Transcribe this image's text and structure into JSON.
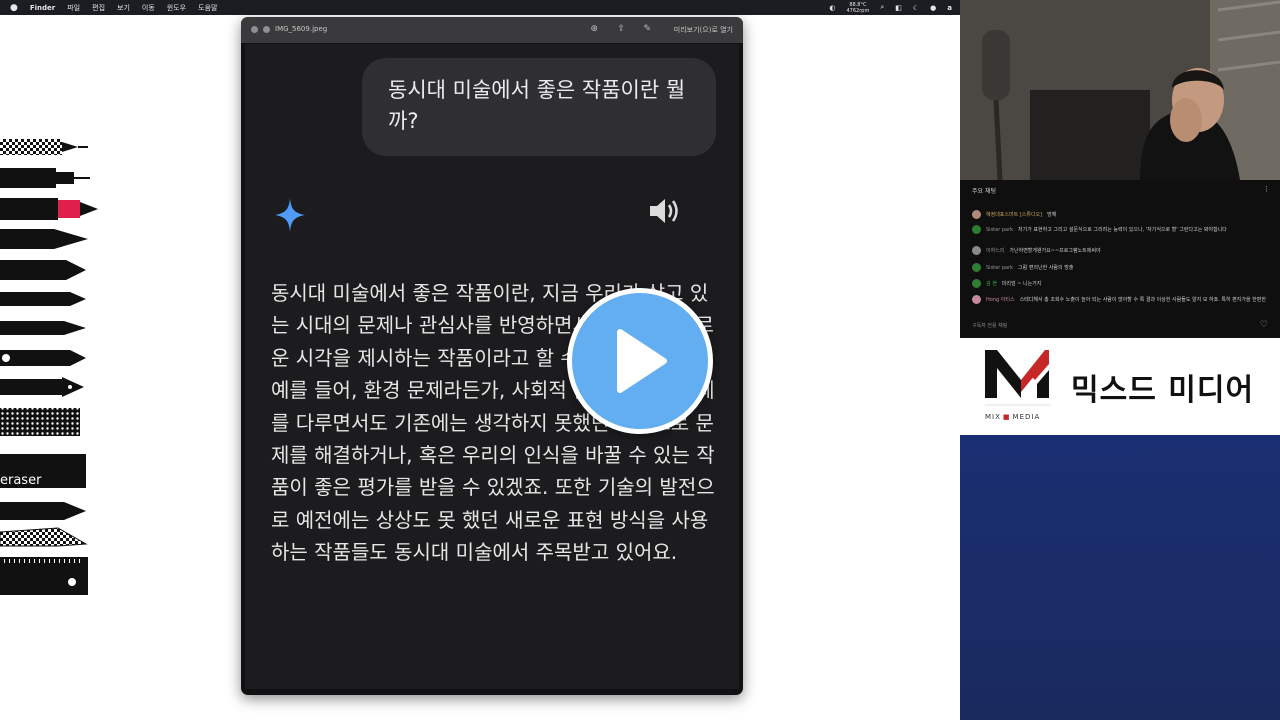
{
  "menubar": {
    "items": [
      "Finder",
      "파일",
      "편집",
      "보기",
      "이동",
      "윈도우",
      "도움말"
    ],
    "weather_temp": "88.8°C",
    "weather_sub": "4762rpm"
  },
  "window": {
    "filename": "IMG_5609.jpeg",
    "open_with": "미리보기(으)로 열기"
  },
  "chat_ui": {
    "prompt": "동시대 미술에서 좋은 작품이란 뭘까?",
    "answer": "동시대 미술에서 좋은 작품이란, 지금 우리가 살고 있는 시대의 문제나 관심사를 반영하면서도 동시에 새로운 시각을 제시하는 작품이라고 할 수 있을 것 같아요. 예를 들어, 환경 문제라든가, 사회적 불평등 같은 주제를 다루면서도 기존에는 생각하지 못했던 방식으로 문제를 해결하거나, 혹은 우리의 인식을 바꿀 수 있는 작품이 좋은 평가를 받을 수 있겠죠. 또한 기술의 발전으로 예전에는 상상도 못 했던 새로운 표현 방식을 사용하는 작품들도 동시대 미술에서 주목받고 있어요."
  },
  "tools": {
    "eraser_label": "eraser"
  },
  "live_chat": {
    "header": "주요 채팅",
    "messages": [
      {
        "name": "혜정대표스마트 [스튜디오]",
        "text": "방해",
        "color": "#c4a35a"
      },
      {
        "name": "Sister park",
        "text": "저기가 표현하고 그리고 설문식으로 그리려는 능력이 있으나, '자기식으로 할' 그런다고는 봐야합니다",
        "color": "#2e7d32"
      },
      {
        "name": "이하느리",
        "text": "가난하면할게왠가요~~프로그램노트에써야",
        "color": "#9e9e9e"
      },
      {
        "name": "Sister park",
        "text": "그럼 편의난한 사람의 방출",
        "color": "#2e7d32"
      },
      {
        "name": "김 현",
        "text": "미리엄 ~ 니는거지",
        "color": "#2e7d32"
      },
      {
        "name": "Hong 아티스",
        "text": "스테디해서 총 조회수 노출이 높아 되는 사람이 많아할 수 록 결과 이상한 사람들도 알지 모 하죠. 특히 편지가을 한편한 네이돈들이 많이죠.",
        "color": "#c48aa0"
      }
    ],
    "footer": "구독자 전용 채팅"
  },
  "brand": {
    "name": "믹스드 미디어",
    "sub_left": "MIX",
    "sub_right": "MEDIA",
    "colors": {
      "red": "#c62828",
      "black": "#111111"
    }
  },
  "accents": {
    "play_blue": "#62aef0",
    "sparkle_blue": "#4f9bf5"
  }
}
